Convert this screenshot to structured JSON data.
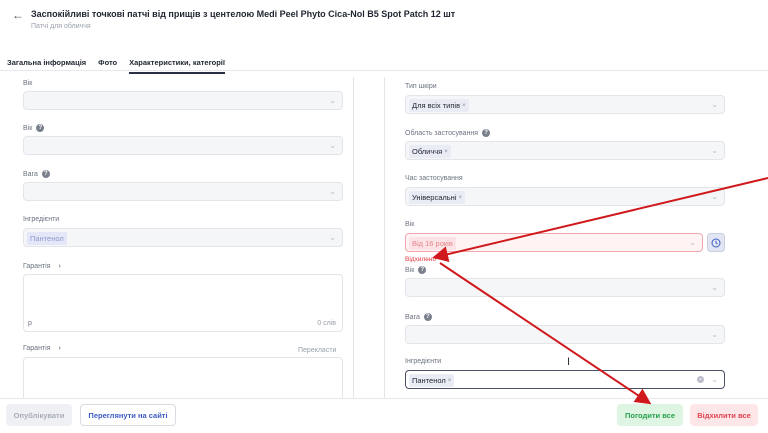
{
  "header": {
    "back_icon": "←",
    "title": "Заспокійливі точкові патчі від прищів з центелою Medi Peel Phyto Cica-Nol B5 Spot Patch 12 шт",
    "subtitle": "Патчі для обличчя"
  },
  "tabs": [
    "Загальна інформація",
    "Фото",
    "Характеристики, категорії"
  ],
  "left": {
    "age_label": "Вік",
    "age2_label": "Вік",
    "weight_label": "Вага",
    "ingredients_label": "Інгредієнти",
    "ingredients_chip": "Пантенол",
    "warranty_label": "Гарантія",
    "warranty_expand": "›",
    "warranty_text": "р",
    "word_count": "0 слів",
    "warranty2_label": "Гарантія",
    "warranty2_expand": "›",
    "translate_label": "Перекласти"
  },
  "right": {
    "skin_type_label": "Тип шкіри",
    "skin_type_chip": "Для всіх типів",
    "application_label": "Область застосування",
    "application_chip": "Обличчя",
    "time_label": "Час застосування",
    "time_chip": "Універсальні",
    "age_label": "Вік",
    "age_chip": "Від 16 років",
    "rejected_text": "Відхилено",
    "age2_label": "Вік",
    "weight_label": "Вага",
    "ingredients_label": "Інгредієнти",
    "ingredients_chip": "Пантенол"
  },
  "footer": {
    "publish": "Опублікувати",
    "view_site": "Переглянути на сайті",
    "approve_all": "Погодити все",
    "reject_all": "Відхилити все"
  },
  "icons": {
    "chevron": "⌄",
    "remove": "×",
    "question": "?",
    "cursor": "I"
  },
  "colors": {
    "accent": "#3d5bc4",
    "error": "#e0323c",
    "approve": "#27a04a",
    "arrow": "#d0191c"
  }
}
